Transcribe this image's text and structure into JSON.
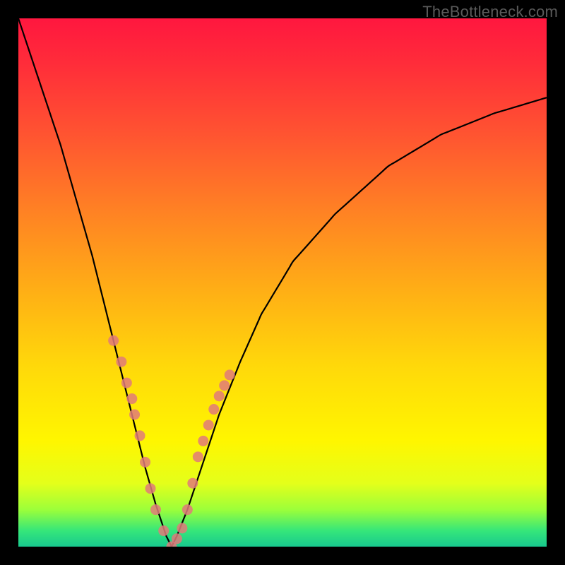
{
  "watermark": "TheBottleneck.com",
  "chart_data": {
    "type": "line",
    "title": "",
    "xlabel": "",
    "ylabel": "",
    "xlim": [
      0,
      100
    ],
    "ylim": [
      0,
      100
    ],
    "optimum_x": 29,
    "series": [
      {
        "name": "bottleneck-curve",
        "x": [
          0,
          2,
          4,
          6,
          8,
          10,
          12,
          14,
          16,
          18,
          20,
          22,
          24,
          26,
          28,
          29,
          30,
          32,
          34,
          36,
          38,
          42,
          46,
          52,
          60,
          70,
          80,
          90,
          100
        ],
        "y": [
          100,
          94,
          88,
          82,
          76,
          69,
          62,
          55,
          47,
          39,
          31,
          23,
          15,
          8,
          2,
          0,
          2,
          7,
          13,
          19,
          25,
          35,
          44,
          54,
          63,
          72,
          78,
          82,
          85
        ]
      }
    ],
    "markers": {
      "name": "sample-points",
      "color": "#e07a7a",
      "x": [
        18,
        19.5,
        20.5,
        21.5,
        22,
        23,
        24,
        25,
        26,
        27.5,
        29,
        30,
        31,
        32,
        33,
        34,
        35,
        36,
        37,
        38,
        39,
        40
      ],
      "y": [
        39,
        35,
        31,
        28,
        25,
        21,
        16,
        11,
        7,
        3,
        0,
        1.5,
        3.5,
        7,
        12,
        17,
        20,
        23,
        26,
        28.5,
        30.5,
        32.5
      ]
    }
  }
}
